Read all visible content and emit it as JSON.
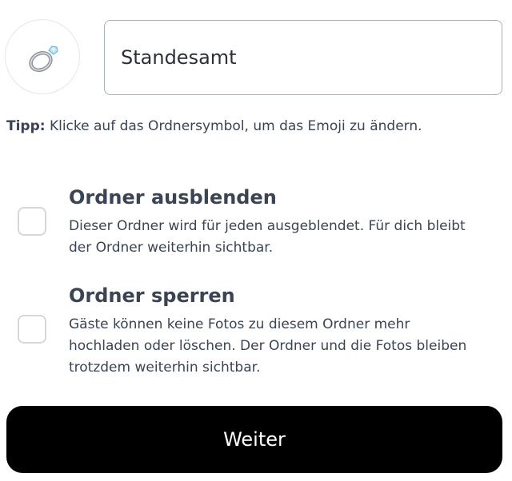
{
  "folder": {
    "icon": "ring-icon",
    "name_value": "Standesamt"
  },
  "tip": {
    "label": "Tipp:",
    "text": " Klicke auf das Ordnersymbol, um das Emoji zu ändern."
  },
  "options": [
    {
      "title": "Ordner ausblenden",
      "description": "Dieser Ordner wird für jeden ausgeblendet. Für dich bleibt der Ordner weiterhin sichtbar.",
      "checked": false
    },
    {
      "title": "Ordner sperren",
      "description": "Gäste können keine Fotos zu diesem Ordner mehr hochladen oder löschen. Der Ordner und die Fotos bleiben trotzdem weiterhin sichtbar.",
      "checked": false
    }
  ],
  "actions": {
    "continue_label": "Weiter"
  }
}
